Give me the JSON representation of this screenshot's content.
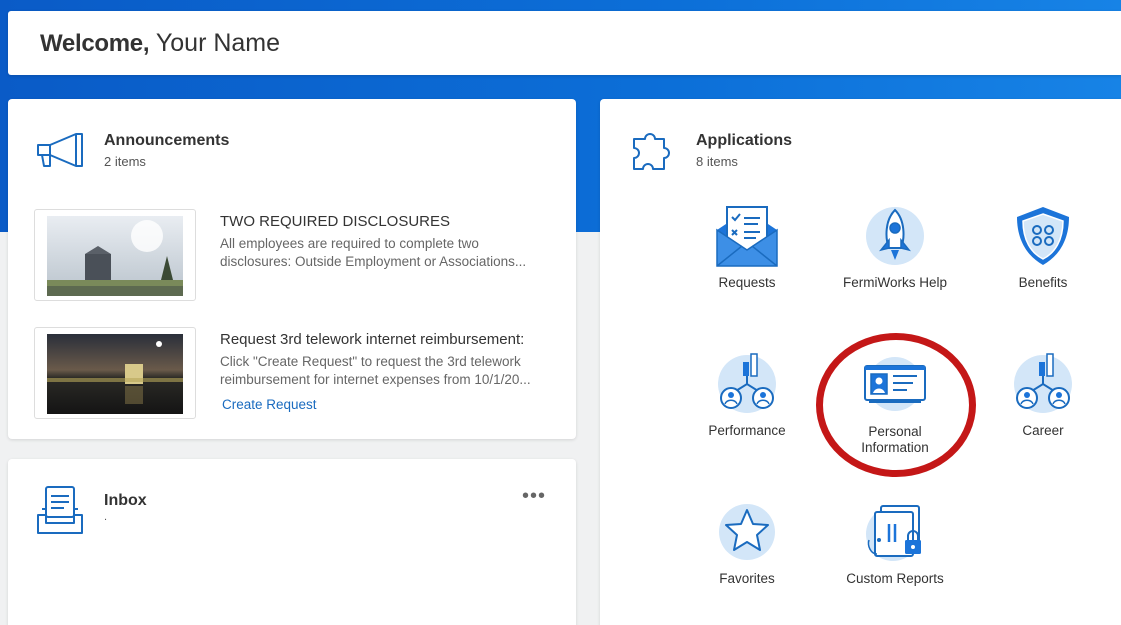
{
  "header": {
    "welcome_label": "Welcome,",
    "user_name": "Your Name"
  },
  "announcements": {
    "title": "Announcements",
    "count_text": "2 items",
    "items": [
      {
        "title": "TWO REQUIRED DISCLOSURES",
        "desc_line1": "All employees are required to complete two",
        "desc_line2": "disclosures: Outside Employment or Associations..."
      },
      {
        "title": "Request 3rd telework internet reimbursement:",
        "desc_line1": "Click \"Create Request\" to request the 3rd telework",
        "desc_line2": "reimbursement for internet expenses from 10/1/20...",
        "link": "Create Request"
      }
    ]
  },
  "inbox": {
    "title": "Inbox",
    "sub": ".",
    "more": "•••"
  },
  "applications": {
    "title": "Applications",
    "count_text": "8 items",
    "items": [
      {
        "label": "Requests",
        "icon": "envelope-checklist-icon"
      },
      {
        "label": "FermiWorks Help",
        "icon": "rocket-icon"
      },
      {
        "label": "Benefits",
        "icon": "shield-icon"
      },
      {
        "label": "Performance",
        "icon": "org-chart-icon"
      },
      {
        "label_line1": "Personal",
        "label_line2": "Information",
        "icon": "id-card-icon"
      },
      {
        "label": "Career",
        "icon": "org-chart-icon"
      },
      {
        "label": "Favorites",
        "icon": "star-icon"
      },
      {
        "label": "Custom Reports",
        "icon": "locked-report-icon"
      }
    ]
  },
  "colors": {
    "brand_blue": "#0c6fd8",
    "icon_blue": "#1a6bbf",
    "highlight_red": "#c41717"
  }
}
